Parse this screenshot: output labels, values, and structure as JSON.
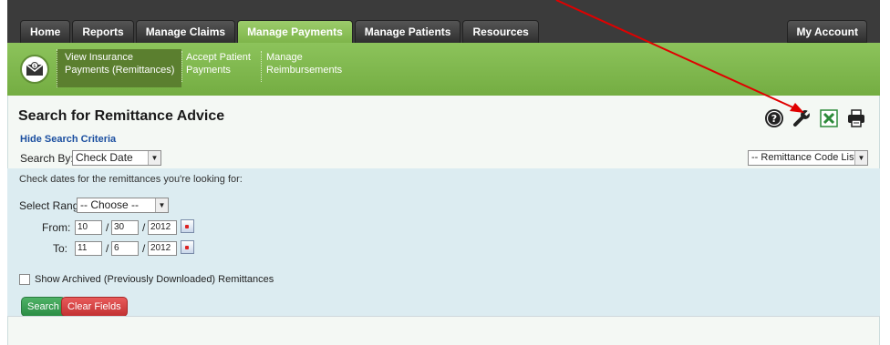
{
  "nav": {
    "tabs": [
      {
        "label": "Home"
      },
      {
        "label": "Reports"
      },
      {
        "label": "Manage Claims"
      },
      {
        "label": "Manage Payments"
      },
      {
        "label": "Manage Patients"
      },
      {
        "label": "Resources"
      }
    ],
    "my_account": "My Account",
    "active_tab": "Manage Payments"
  },
  "subnav": {
    "icon": "money-envelope-icon",
    "items": [
      {
        "line1": "View Insurance",
        "line2": "Payments (Remittances)"
      },
      {
        "line1": "Accept Patient",
        "line2": "Payments"
      },
      {
        "line1": "Manage",
        "line2": "Reimbursements"
      }
    ]
  },
  "page": {
    "title": "Search for Remittance Advice",
    "hide_criteria": "Hide Search Criteria",
    "search_by_label": "Search By:",
    "search_by_value": "Check Date",
    "code_list_value": "-- Remittance Code List --"
  },
  "tools": [
    "help-icon",
    "wrench-icon",
    "excel-icon",
    "print-icon"
  ],
  "criteria": {
    "hint": "Check dates for the remittances you're looking for:",
    "range_label": "Select Range:",
    "range_value": "-- Choose --",
    "from_label": "From:",
    "from": {
      "month": "10",
      "day": "30",
      "year": "2012"
    },
    "to_label": "To:",
    "to": {
      "month": "11",
      "day": "6",
      "year": "2012"
    },
    "slash": "/",
    "archived_label": "Show Archived (Previously Downloaded) Remittances",
    "archived_checked": false,
    "search_button": "Search",
    "clear_button": "Clear Fields"
  },
  "colors": {
    "accent_green": "#8cc35b",
    "link_blue": "#1b4fa0",
    "criteria_bg": "#dcecf1",
    "annotation_arrow": "#e00000"
  }
}
